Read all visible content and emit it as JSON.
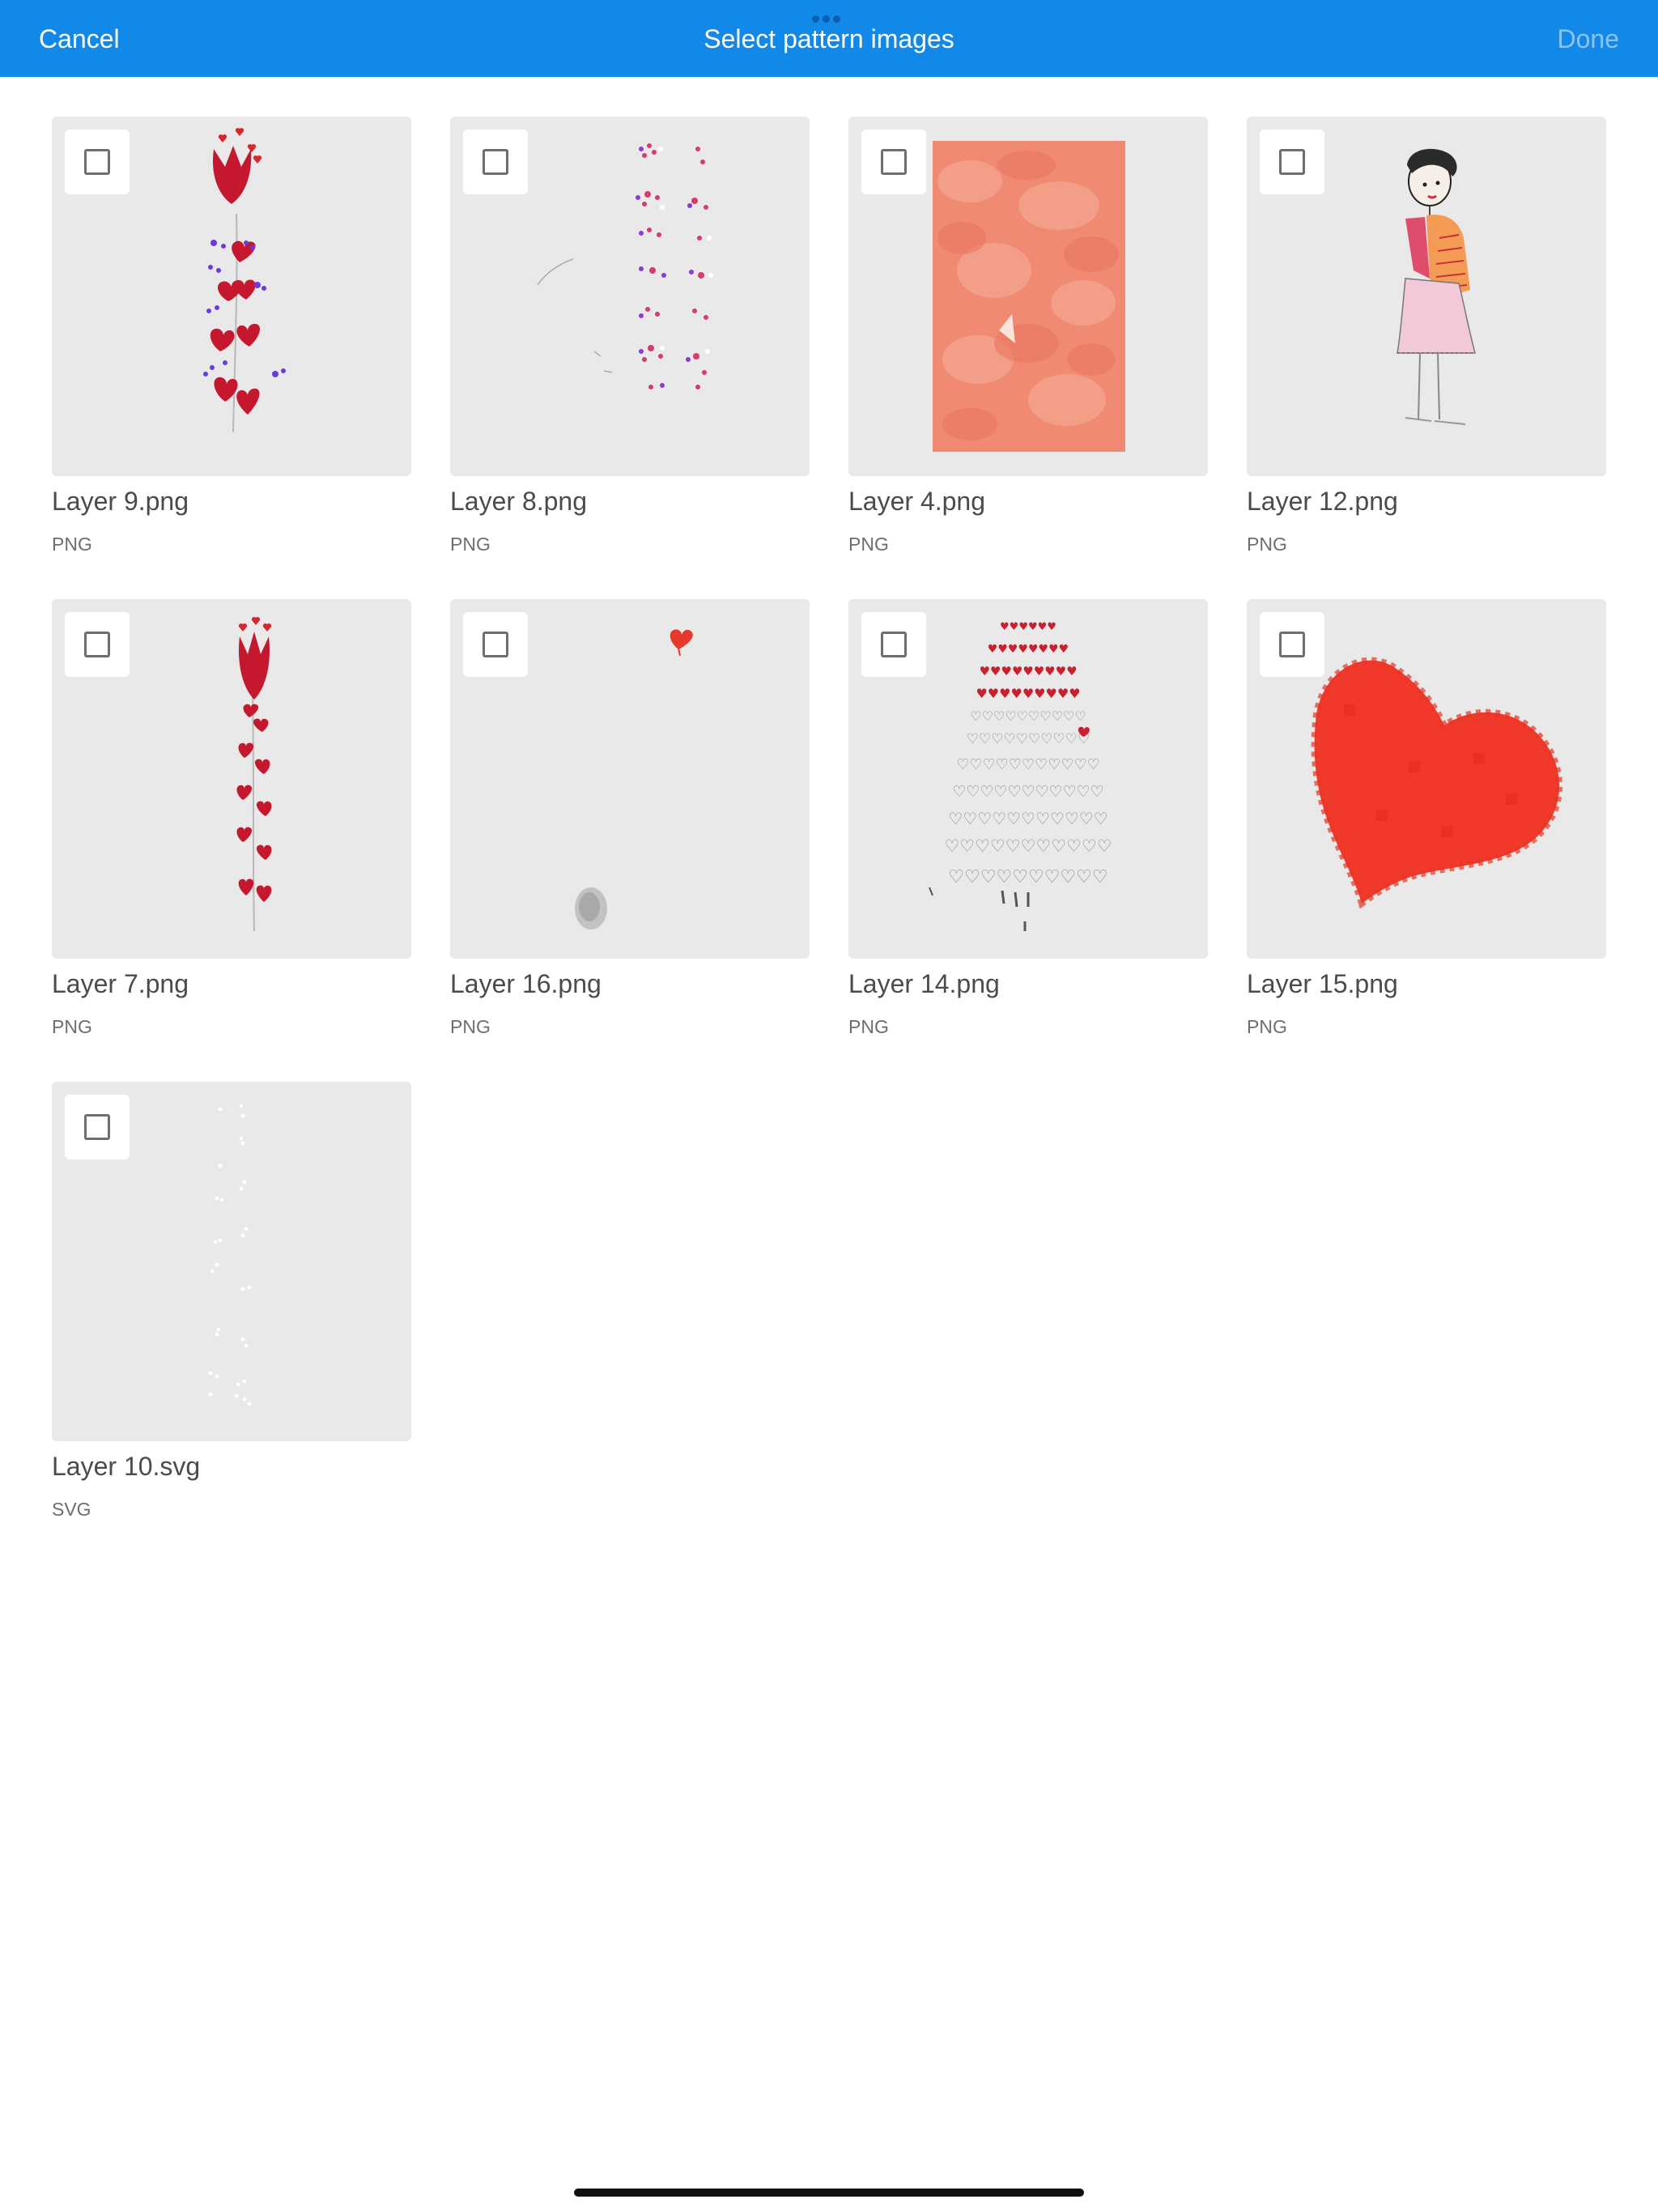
{
  "header": {
    "cancel_label": "Cancel",
    "title": "Select pattern images",
    "done_label": "Done",
    "background_color": "#1289e8",
    "done_state": "disabled"
  },
  "images": [
    {
      "name": "Layer 9.png",
      "type": "PNG",
      "selected": false,
      "thumbnail": "red-flower-stem-with-purple-hearts"
    },
    {
      "name": "Layer 8.png",
      "type": "PNG",
      "selected": false,
      "thumbnail": "columns-of-small-pink-purple-hearts"
    },
    {
      "name": "Layer 4.png",
      "type": "PNG",
      "selected": false,
      "thumbnail": "coral-watercolor-rectangle"
    },
    {
      "name": "Layer 12.png",
      "type": "PNG",
      "selected": false,
      "thumbnail": "sketch-of-girl-with-orange-scarf"
    },
    {
      "name": "Layer 7.png",
      "type": "PNG",
      "selected": false,
      "thumbnail": "tall-red-flower-stem"
    },
    {
      "name": "Layer 16.png",
      "type": "PNG",
      "selected": false,
      "thumbnail": "small-red-heart-and-gray-smudge"
    },
    {
      "name": "Layer 14.png",
      "type": "PNG",
      "selected": false,
      "thumbnail": "tree-of-outlined-hearts"
    },
    {
      "name": "Layer 15.png",
      "type": "PNG",
      "selected": false,
      "thumbnail": "large-red-pixel-heart"
    },
    {
      "name": "Layer 10.svg",
      "type": "SVG",
      "selected": false,
      "thumbnail": "faint-white-dots"
    }
  ]
}
